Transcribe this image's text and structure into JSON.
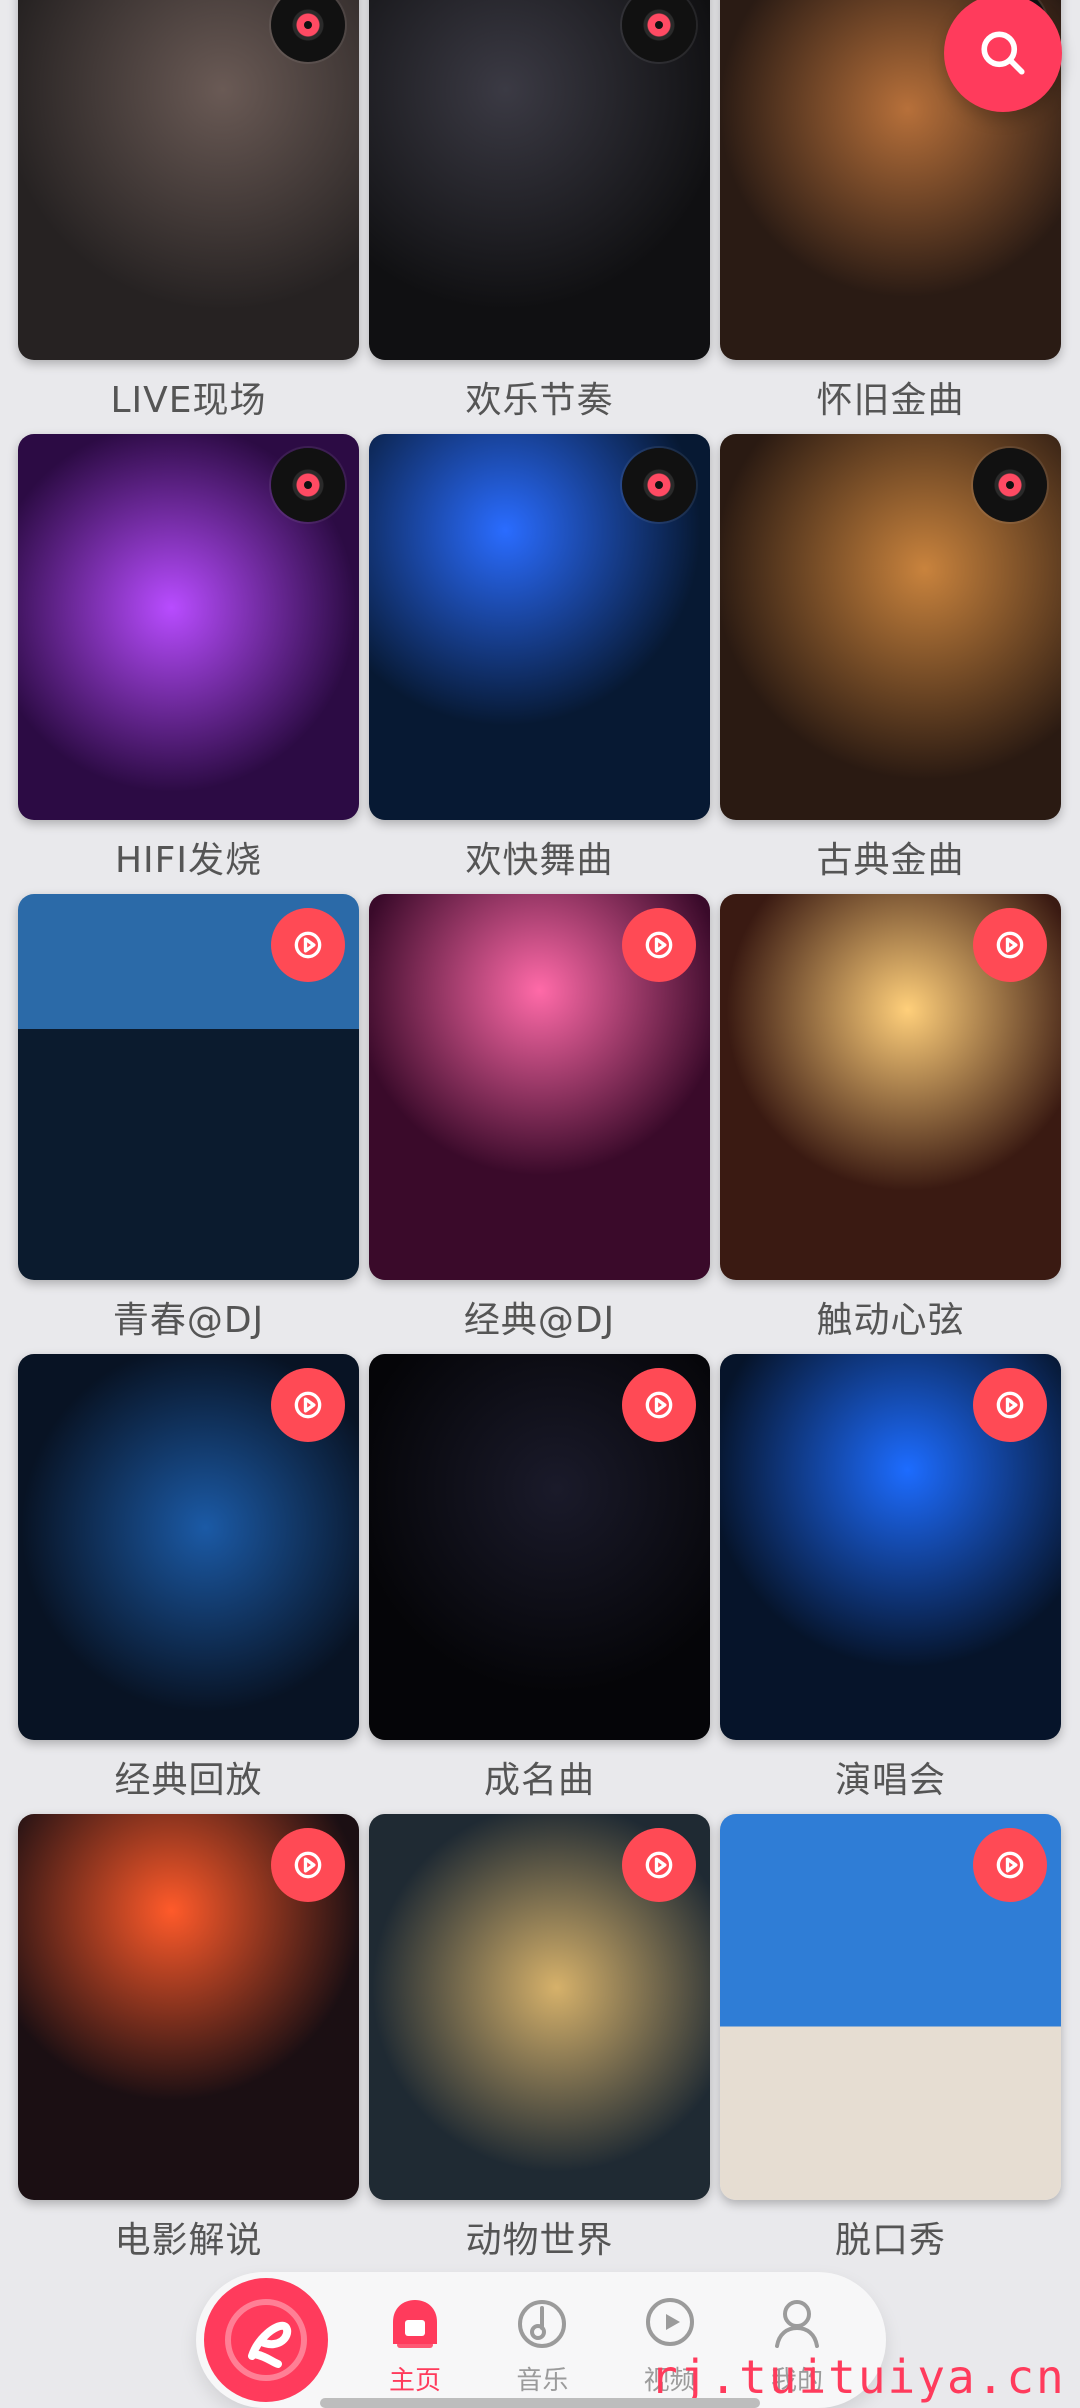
{
  "colors": {
    "accent": "#ff3b5c",
    "background": "#e9e9ec",
    "label": "#555555",
    "nav_inactive": "#9b9b9b"
  },
  "fab": {
    "icon": "search-icon"
  },
  "categories": [
    {
      "label": "LIVE现场",
      "badge": "record-icon",
      "icon": "crowd"
    },
    {
      "label": "欢乐节奏",
      "badge": "record-icon",
      "icon": "dj"
    },
    {
      "label": "怀旧金曲",
      "badge": "record-icon",
      "icon": "studio"
    },
    {
      "label": "HIFI发烧",
      "badge": "record-icon",
      "icon": "turntable"
    },
    {
      "label": "欢快舞曲",
      "badge": "record-icon",
      "icon": "street-party"
    },
    {
      "label": "古典金曲",
      "badge": "record-icon",
      "icon": "violin"
    },
    {
      "label": "青春@DJ",
      "badge": "play-icon",
      "icon": "girl"
    },
    {
      "label": "经典@DJ",
      "badge": "play-icon",
      "icon": "concert"
    },
    {
      "label": "触动心弦",
      "badge": "play-icon",
      "icon": "dancers"
    },
    {
      "label": "经典回放",
      "badge": "play-icon",
      "icon": "guitar"
    },
    {
      "label": "成名曲",
      "badge": "play-icon",
      "icon": "singer"
    },
    {
      "label": "演唱会",
      "badge": "play-icon",
      "icon": "stage"
    },
    {
      "label": "电影解说",
      "badge": "play-icon",
      "icon": "movie-street"
    },
    {
      "label": "动物世界",
      "badge": "play-icon",
      "icon": "leopard"
    },
    {
      "label": "脱口秀",
      "badge": "play-icon",
      "icon": "dog"
    }
  ],
  "bottom_nav": {
    "logo_icon": "app-logo-icon",
    "items": [
      {
        "label": "主页",
        "icon": "home-icon",
        "active": true
      },
      {
        "label": "音乐",
        "icon": "music-icon",
        "active": false
      },
      {
        "label": "视频",
        "icon": "video-icon",
        "active": false
      },
      {
        "label": "我的",
        "icon": "user-icon",
        "active": false
      }
    ]
  },
  "watermark": "rj.tuituiya.cn"
}
